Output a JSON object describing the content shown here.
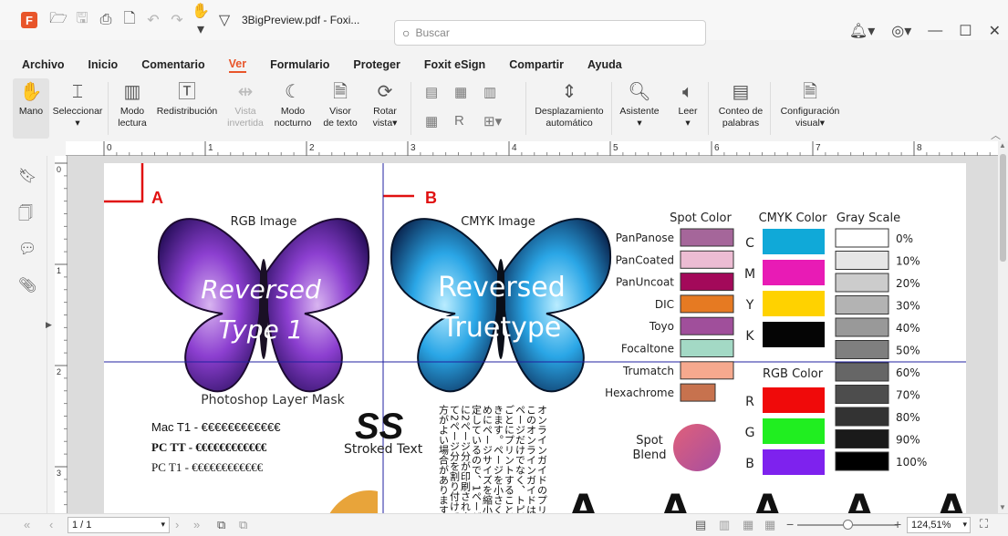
{
  "titlebar": {
    "logo": "F",
    "doc_title": "3BigPreview.pdf - Foxi...",
    "search_placeholder": "Buscar"
  },
  "menu": [
    "Archivo",
    "Inicio",
    "Comentario",
    "Ver",
    "Formulario",
    "Proteger",
    "Foxit eSign",
    "Compartir",
    "Ayuda"
  ],
  "ribbon": {
    "hand": "Mano",
    "select": "Seleccionar",
    "read_mode": [
      "Modo",
      "lectura"
    ],
    "reflow": "Redistribución",
    "inverted": [
      "Vista",
      "invertida"
    ],
    "night": [
      "Modo",
      "nocturno"
    ],
    "text_viewer": [
      "Visor",
      "de texto"
    ],
    "rotate": [
      "Rotar",
      "vista▾"
    ],
    "autoscroll": [
      "Desplazamiento",
      "automático"
    ],
    "assistant": "Asistente",
    "read": "Leer",
    "word_count": [
      "Conteo de",
      "palabras"
    ],
    "visual_config": [
      "Configuración",
      "visual▾"
    ]
  },
  "ruler": {
    "top": [
      "0",
      "1",
      "2",
      "3",
      "4",
      "5",
      "6",
      "7",
      "8"
    ],
    "left": [
      "0",
      "1",
      "2",
      "3"
    ]
  },
  "page": {
    "marker_a": "A",
    "marker_b": "B",
    "rgb_image": "RGB Image",
    "cmyk_image": "CMYK Image",
    "reversed_type1": [
      "Reversed",
      "Type 1"
    ],
    "reversed_truetype": [
      "Reversed",
      "Truetype"
    ],
    "photoshop_mask": "Photoshop Layer Mask",
    "font_lines": [
      "Mac T1 - €€€€€€€€€€€€",
      "PC TT - €€€€€€€€€€€€",
      "PC T1 - €€€€€€€€€€€€"
    ],
    "ss": "SS",
    "stroked_text": "Stroked Text",
    "japanese_cols": [
      "オンラインガイドのプリント",
      "このオンラインガイドは、合",
      "ページだけでなく、トピッ",
      "ごとにプリントすることが",
      "きます。ページを小さくし",
      "めにページサイズを縮小表示",
      "定しているので、1ページ",
      "に2ページ分が印刷されま",
      "て2ページ分を割り付けて",
      "方がよい場合があります。"
    ],
    "spot_color_title": "Spot Color",
    "spot_colors": [
      {
        "label": "PanPanose",
        "color": "#a5669a"
      },
      {
        "label": "PanCoated",
        "color": "#ecbcd3"
      },
      {
        "label": "PanUncoat",
        "color": "#a3095a"
      },
      {
        "label": "DIC",
        "color": "#e67a22"
      },
      {
        "label": "Toyo",
        "color": "#a04f9b"
      },
      {
        "label": "Focaltone",
        "color": "#a3d9c5"
      },
      {
        "label": "Trumatch",
        "color": "#f6a98e"
      },
      {
        "label": "Hexachrome",
        "color": "#c7724e"
      }
    ],
    "spot_blend": [
      "Spot",
      "Blend"
    ],
    "cmyk_title": "CMYK Color",
    "cmyk": [
      {
        "label": "C",
        "color": "#10a9d8"
      },
      {
        "label": "M",
        "color": "#e81bb5"
      },
      {
        "label": "Y",
        "color": "#ffd200"
      },
      {
        "label": "K",
        "color": "#050505"
      }
    ],
    "rgb_title": "RGB Color",
    "rgb": [
      {
        "label": "R",
        "color": "#f00a0a"
      },
      {
        "label": "G",
        "color": "#20ee20"
      },
      {
        "label": "B",
        "color": "#7e22ee"
      }
    ],
    "gray_title": "Gray Scale",
    "gray": [
      {
        "label": "0%",
        "color": "#ffffff"
      },
      {
        "label": "10%",
        "color": "#e6e6e6"
      },
      {
        "label": "20%",
        "color": "#cccccc"
      },
      {
        "label": "30%",
        "color": "#b3b3b3"
      },
      {
        "label": "40%",
        "color": "#999999"
      },
      {
        "label": "50%",
        "color": "#7f7f7f"
      },
      {
        "label": "60%",
        "color": "#666666"
      },
      {
        "label": "70%",
        "color": "#4d4d4d"
      },
      {
        "label": "80%",
        "color": "#333333"
      },
      {
        "label": "90%",
        "color": "#1a1a1a"
      },
      {
        "label": "100%",
        "color": "#000000"
      }
    ],
    "big_letters": "A A A A A A"
  },
  "status": {
    "page": "1 / 1",
    "zoom": "124,51%"
  },
  "colors": {
    "accent": "#e8552a",
    "guide": "#2020a0",
    "marker": "#e01010"
  }
}
